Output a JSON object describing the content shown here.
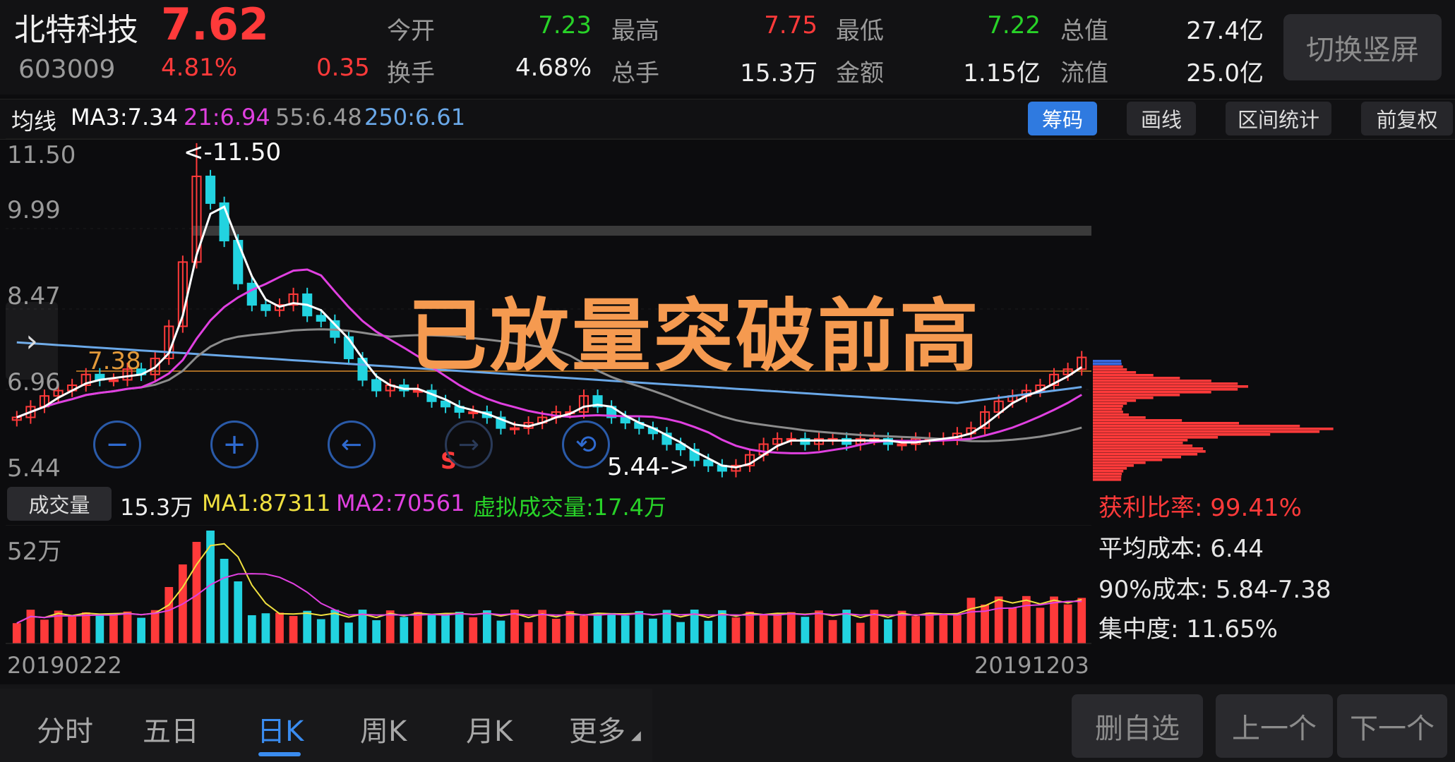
{
  "stock": {
    "name": "北特科技",
    "code": "603009",
    "price": "7.62",
    "change_pct": "4.81%",
    "change": "0.35"
  },
  "quote": [
    {
      "label": "今开",
      "value": "7.23",
      "color": "#28d228"
    },
    {
      "label": "最高",
      "value": "7.75",
      "color": "#ff3a3a"
    },
    {
      "label": "最低",
      "value": "7.22",
      "color": "#28d228"
    },
    {
      "label": "总值",
      "value": "27.4亿",
      "color": "#eeeeee"
    },
    {
      "label": "换手",
      "value": "4.68%",
      "color": "#eeeeee"
    },
    {
      "label": "总手",
      "value": "15.3万",
      "color": "#eeeeee"
    },
    {
      "label": "金额",
      "value": "1.15亿",
      "color": "#eeeeee"
    },
    {
      "label": "流值",
      "value": "25.0亿",
      "color": "#eeeeee"
    }
  ],
  "switch_button": "切换竖屏",
  "ma_bar": {
    "label": "均线",
    "ma3": "MA3:7.34",
    "ma21": "21:6.94",
    "ma55": "55:6.48",
    "ma250": "250:6.61"
  },
  "tools": [
    "筹码",
    "画线",
    "区间统计",
    "前复权"
  ],
  "overlay_text": "已放量突破前高",
  "price_axis": [
    "11.50",
    "9.99",
    "8.47",
    "6.96",
    "5.44"
  ],
  "price_annotations": {
    "high": "<-11.50",
    "low": "5.44->",
    "level": "7.38",
    "signal": "S"
  },
  "volume": {
    "button": "成交量",
    "current": "15.3万",
    "ma1": "MA1:87311",
    "ma2": "MA2:70561",
    "virtual": "虚拟成交量:17.4万",
    "axis_top": "52万"
  },
  "chip_stats": {
    "profit_ratio": "获利比率: 99.41%",
    "avg_cost": "平均成本: 6.44",
    "cost90": "90%成本: 5.84-7.38",
    "concentration": "集中度: 11.65%"
  },
  "dates": {
    "start": "20190222",
    "end": "20191203"
  },
  "tabs": [
    "分时",
    "五日",
    "日K",
    "周K",
    "月K",
    "更多"
  ],
  "active_tab": "日K",
  "nav_buttons": [
    "删自选",
    "上一个",
    "下一个"
  ],
  "colors": {
    "up": "#ff3a3a",
    "down": "#22d3e0",
    "ma3": "#ffffff",
    "ma21": "#e040e0",
    "ma55": "#9a9a9a",
    "ma250": "#6aa8e8",
    "accent": "#2f7ae0",
    "overlay": "#f59a50"
  },
  "chart_data": {
    "type": "candlestick",
    "x_range": [
      "20190222",
      "20191203"
    ],
    "ylim": [
      5.44,
      11.5
    ],
    "close": [
      6.5,
      6.7,
      6.9,
      7.0,
      7.1,
      7.3,
      7.2,
      7.2,
      7.4,
      7.3,
      7.6,
      8.2,
      9.4,
      11.0,
      10.5,
      9.8,
      9.0,
      8.6,
      8.5,
      8.6,
      8.8,
      8.4,
      8.3,
      8.0,
      7.6,
      7.2,
      7.0,
      7.1,
      7.0,
      7.0,
      6.8,
      6.7,
      6.6,
      6.6,
      6.5,
      6.3,
      6.3,
      6.4,
      6.5,
      6.6,
      6.6,
      6.9,
      6.7,
      6.5,
      6.4,
      6.3,
      6.2,
      6.0,
      5.9,
      5.7,
      5.6,
      5.5,
      5.6,
      5.8,
      6.0,
      6.1,
      6.1,
      6.0,
      6.1,
      6.1,
      6.0,
      6.1,
      6.1,
      6.0,
      6.0,
      6.1,
      6.1,
      6.1,
      6.2,
      6.3,
      6.6,
      6.8,
      6.9,
      7.0,
      7.1,
      7.3,
      7.4,
      7.62
    ],
    "volume_max": "52万"
  }
}
